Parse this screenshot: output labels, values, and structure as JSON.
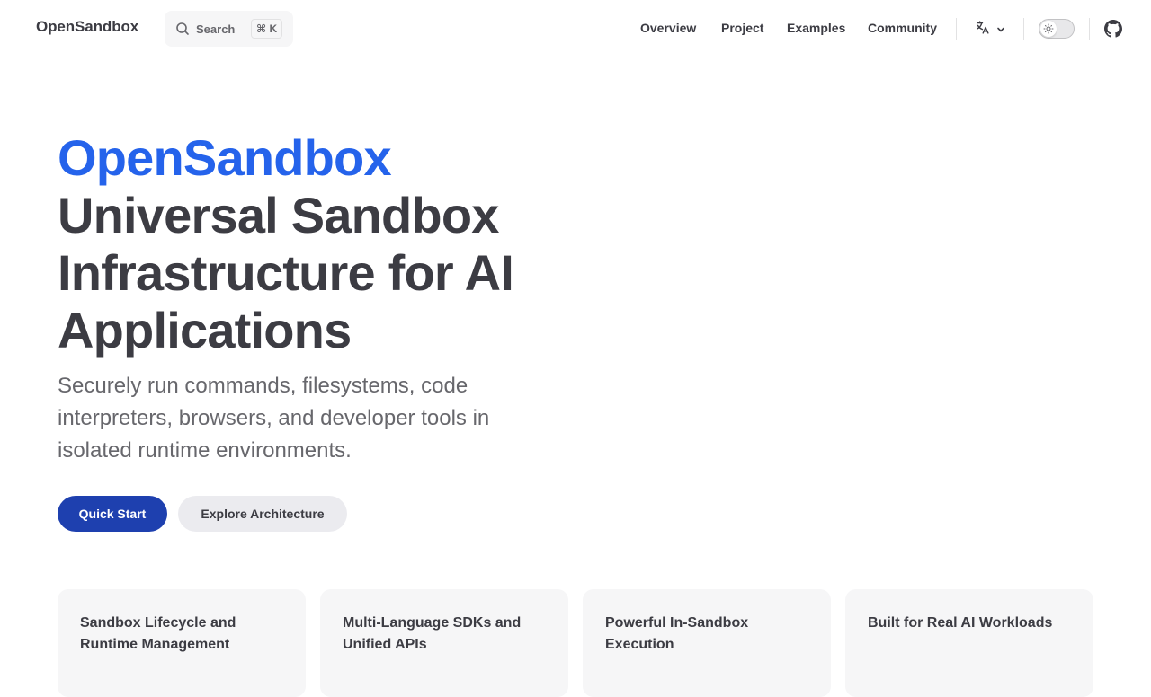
{
  "nav": {
    "brand": "OpenSandbox",
    "search_label": "Search",
    "search_shortcut": "⌘ K",
    "links": [
      "Overview",
      "Project",
      "Examples",
      "Community"
    ],
    "icons": {
      "search": "search-icon",
      "language": "translate-icon",
      "chevron": "chevron-down-icon",
      "theme": "sun-icon",
      "github": "github-icon"
    }
  },
  "hero": {
    "name": "OpenSandbox",
    "text": "Universal Sandbox Infrastructure for AI Applications",
    "tagline": "Securely run commands, filesystems, code interpreters, browsers, and developer tools in isolated runtime environments.",
    "primary_action": "Quick Start",
    "secondary_action": "Explore Architecture"
  },
  "features": [
    {
      "title": "Sandbox Lifecycle and Runtime Management"
    },
    {
      "title": "Multi-Language SDKs and Unified APIs"
    },
    {
      "title": "Powerful In-Sandbox Execution"
    },
    {
      "title": "Built for Real AI Workloads"
    }
  ],
  "colors": {
    "brand_blue": "#2563eb",
    "primary_button": "#1e40af",
    "text": "#3c3c43",
    "muted": "#67676c"
  }
}
